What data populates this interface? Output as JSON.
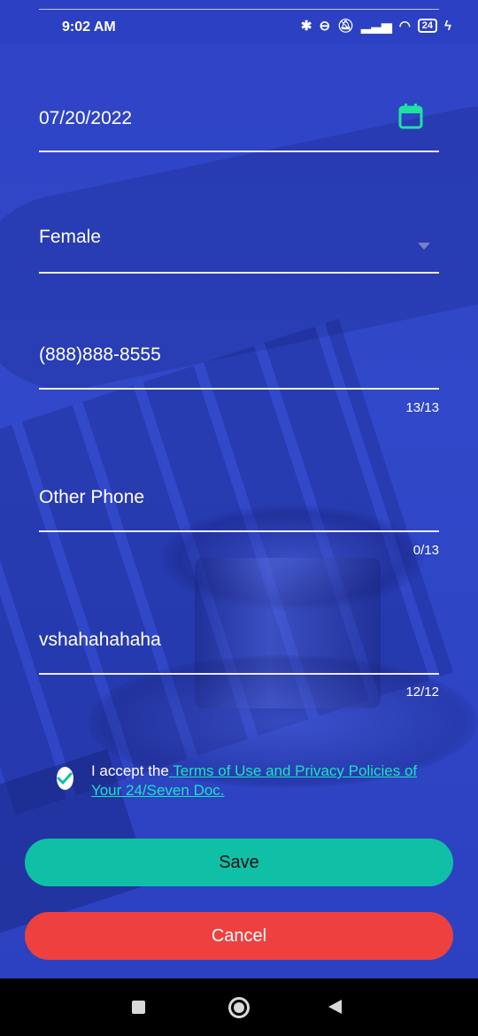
{
  "status_bar": {
    "time": "9:02 AM",
    "icons": [
      "bluetooth-icon",
      "toggle-icon",
      "mute-icon",
      "signal-icon",
      "wifi-icon",
      "battery-icon"
    ],
    "battery": "24"
  },
  "form": {
    "date": {
      "value": "07/20/2022",
      "icon": "calendar-icon"
    },
    "gender": {
      "value": "Female"
    },
    "phone": {
      "value": "(888)888-8555",
      "counter": "13/13"
    },
    "other_phone": {
      "placeholder": "Other Phone",
      "counter": "0/13"
    },
    "name": {
      "value": "vshahahahaha",
      "counter": "12/12"
    }
  },
  "terms": {
    "checked": true,
    "prefix": "I accept the",
    "link": " Terms of Use and Privacy Policies of Your 24/Seven Doc."
  },
  "buttons": {
    "save": "Save",
    "cancel": "Cancel"
  },
  "colors": {
    "accent": "#10c0a6",
    "danger": "#ef4040",
    "link": "#1de2c0",
    "background": "#2f45c8"
  }
}
